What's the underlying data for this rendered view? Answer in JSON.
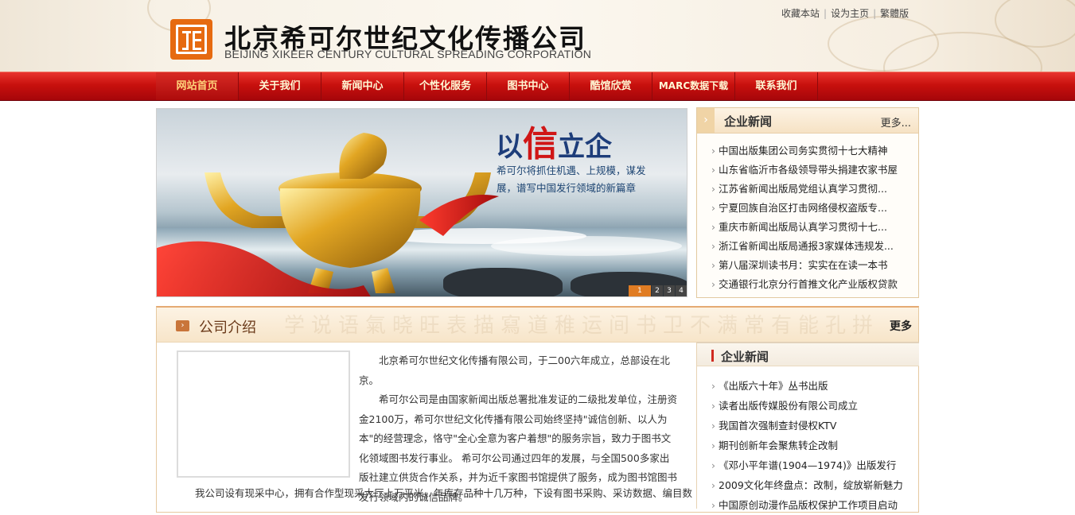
{
  "header": {
    "company_cn": "北京希可尔世纪文化传播公司",
    "company_en": "BEIJING XIKEER CENTURY CULTURAL SPREADING CORPORATION",
    "links": [
      "收藏本站",
      "设为主页",
      "繁體版"
    ]
  },
  "nav": {
    "items": [
      "网站首页",
      "关于我们",
      "新闻中心",
      "个性化服务",
      "图书中心",
      "酷馆欣赏",
      "MARC数据下载",
      "联系我们"
    ],
    "active": "网站首页"
  },
  "banner": {
    "slogan_left": "以",
    "slogan_red": "信",
    "slogan_right": "立企",
    "subtitle": "希可尔将抓住机遇、上规模，谋发展，谱写中国发行领域的新篇章",
    "pages": [
      "1",
      "2",
      "3",
      "4"
    ]
  },
  "news_box_1": {
    "title": "企业新闻",
    "more": "更多...",
    "items": [
      "中国出版集团公司务实贯彻十七大精神",
      "山东省临沂市各级领导带头捐建农家书屋",
      "江苏省新闻出版局党组认真学习贯彻...",
      "宁夏回族自治区打击网络侵权盗版专...",
      "重庆市新闻出版局认真学习贯彻十七...",
      "浙江省新闻出版局通报3家媒体违规发...",
      "第八届深圳读书月：实实在在读一本书",
      "交通银行北京分行首推文化产业版权贷款"
    ]
  },
  "intro": {
    "title": "公司介绍",
    "more": "更多",
    "calligraphy": "学说语氣晓旺表描寫道稚运间书卫不满常有能孔拼",
    "para1": "北京希可尔世纪文化传播有限公司，于二00六年成立，总部设在北京。",
    "para2": "希可尔公司是由国家新闻出版总署批准发证的二级批发单位，注册资金2100万，希可尔世纪文化传播有限公司始终坚持\"诚信创新、以人为本\"的经营理念，恪守\"全心全意为客户着想\"的服务宗旨，致力于图书文化领域图书发行事业。 希可尔公司通过四年的发展，与全国500多家出版社建立供货合作关系，并为近千家图书馆提供了服务，成为图书馆图书发行领域内的诚信品牌。",
    "para3": "我公司设有现采中心，拥有合作型现采大厅上万平米，年库存品种十几万种，下设有图书采购、采访数据、编目数"
  },
  "news_box_2": {
    "title": "企业新闻",
    "items": [
      "《出版六十年》丛书出版",
      "读者出版传媒股份有限公司成立",
      "我国首次强制查封侵权KTV",
      "期刊创新年会聚焦转企改制",
      "《邓小平年谱(1904—1974)》出版发行",
      "2009文化年终盘点：改制，绽放崭新魅力",
      "中国原创动漫作品版权保护工作项目启动"
    ]
  }
}
